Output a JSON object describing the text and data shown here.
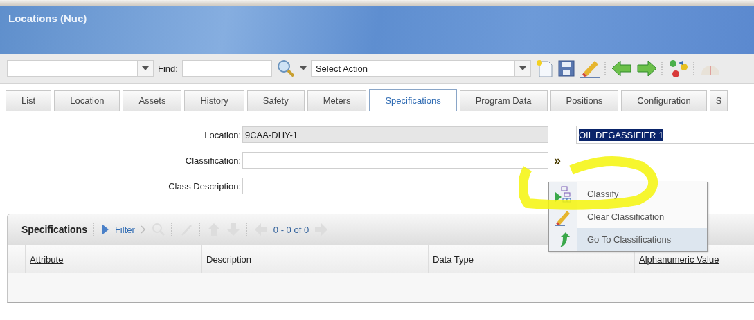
{
  "header": {
    "title": "Locations (Nuc)"
  },
  "toolbar": {
    "find_label": "Find:",
    "action_select": "Select Action"
  },
  "tabs": [
    {
      "label": "List",
      "selected": false
    },
    {
      "label": "Location",
      "selected": false
    },
    {
      "label": "Assets",
      "selected": false
    },
    {
      "label": "History",
      "selected": false
    },
    {
      "label": "Safety",
      "selected": false
    },
    {
      "label": "Meters",
      "selected": false
    },
    {
      "label": "Specifications",
      "selected": true
    },
    {
      "label": "Program Data",
      "selected": false
    },
    {
      "label": "Positions",
      "selected": false
    },
    {
      "label": "Configuration",
      "selected": false
    },
    {
      "label": "S",
      "selected": false
    }
  ],
  "form": {
    "fields": [
      {
        "label": "Location:",
        "value": "9CAA-DHY-1",
        "readonly": true
      },
      {
        "label": "Classification:",
        "readonly": false,
        "action": "»"
      },
      {
        "label": "Class Description:",
        "readonly": false
      }
    ],
    "description": {
      "value": "OIL DEGASSIFIER 1",
      "highlighted": true
    }
  },
  "menu": {
    "items": [
      {
        "kind": "classify",
        "label": "Classify",
        "selected": false
      },
      {
        "kind": "clear",
        "label": "Clear Classification",
        "selected": false
      },
      {
        "kind": "goto",
        "label": "Go To Classifications",
        "selected": true
      }
    ]
  },
  "specifications": {
    "title": "Specifications",
    "filter": "Filter",
    "count": "0 - 0 of 0",
    "columns": [
      {
        "label": "Attribute",
        "sortable": true
      },
      {
        "label": "Description",
        "sortable": false
      },
      {
        "label": "Data Type",
        "sortable": false
      },
      {
        "label": "Alphanumeric Value",
        "sortable": true
      }
    ]
  }
}
